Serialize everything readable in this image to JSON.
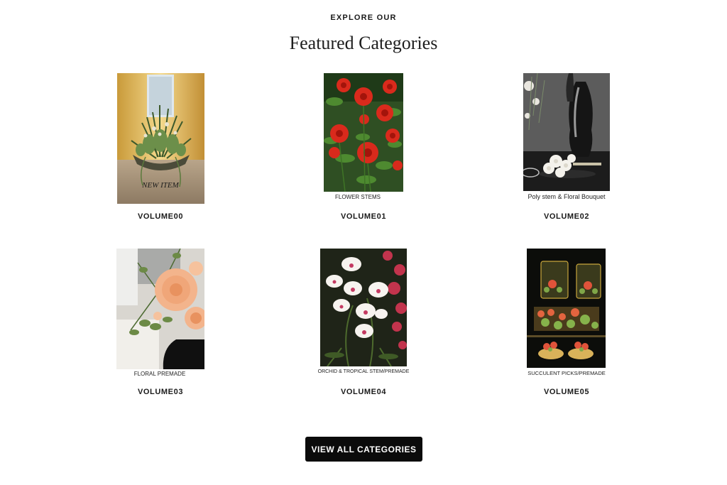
{
  "section": {
    "eyebrow": "EXPLORE OUR",
    "title": "Featured Categories"
  },
  "categories": [
    {
      "label": "VOLUME00",
      "image_text": "NEW ITEM"
    },
    {
      "label": "VOLUME01",
      "image_text": "FLOWER STEMS"
    },
    {
      "label": "VOLUME02",
      "image_text": "Poly stem & Floral Bouquet"
    },
    {
      "label": "VOLUME03",
      "image_text": "FLORAL PREMADE"
    },
    {
      "label": "VOLUME04",
      "image_text": "ORCHID & TROPICAL STEM/PREMADE"
    },
    {
      "label": "VOLUME05",
      "image_text": "SUCCULENT PICKS/PREMADE"
    }
  ],
  "cta": {
    "label": "VIEW ALL CATEGORIES"
  }
}
